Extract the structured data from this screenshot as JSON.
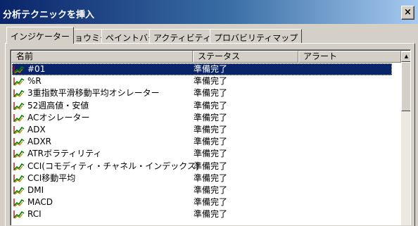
{
  "window": {
    "title": "分析テクニックを挿入",
    "close_label": "×"
  },
  "tabs": [
    {
      "label": "インジケーター",
      "active": true
    },
    {
      "label": "ショウミー"
    },
    {
      "label": "ペイントバー"
    },
    {
      "label": "アクティビティバー"
    },
    {
      "label": "プロバビリティマップ"
    }
  ],
  "list": {
    "columns": [
      "名前",
      "ステータス",
      "アラート"
    ],
    "items": [
      {
        "name": "#01",
        "status": "準備完了",
        "selected": true
      },
      {
        "name": "%R",
        "status": "準備完了"
      },
      {
        "name": "3重指数平滑移動平均オシレーター",
        "status": "準備完了"
      },
      {
        "name": "52週高値・安値",
        "status": "準備完了"
      },
      {
        "name": "ACオシレーター",
        "status": "準備完了"
      },
      {
        "name": "ADX",
        "status": "準備完了"
      },
      {
        "name": "ADXR",
        "status": "準備完了"
      },
      {
        "name": "ATRボラティリティ",
        "status": "準備完了"
      },
      {
        "name": "CCI(コモディティ・チャネル・インデックス)",
        "status": "準備完了"
      },
      {
        "name": "CCI移動平均",
        "status": "準備完了"
      },
      {
        "name": "DMI",
        "status": "準備完了"
      },
      {
        "name": "MACD",
        "status": "準備完了"
      },
      {
        "name": "RCI",
        "status": "準備完了"
      }
    ],
    "item_icon": "indicator-chart-icon"
  },
  "scrollbar": {
    "up_arrow": "▲"
  },
  "colors": {
    "title_gradient_start": "#0a246a",
    "title_gradient_end": "#a6caf0",
    "selection": "#0a246a",
    "face": "#d4d0c8"
  }
}
